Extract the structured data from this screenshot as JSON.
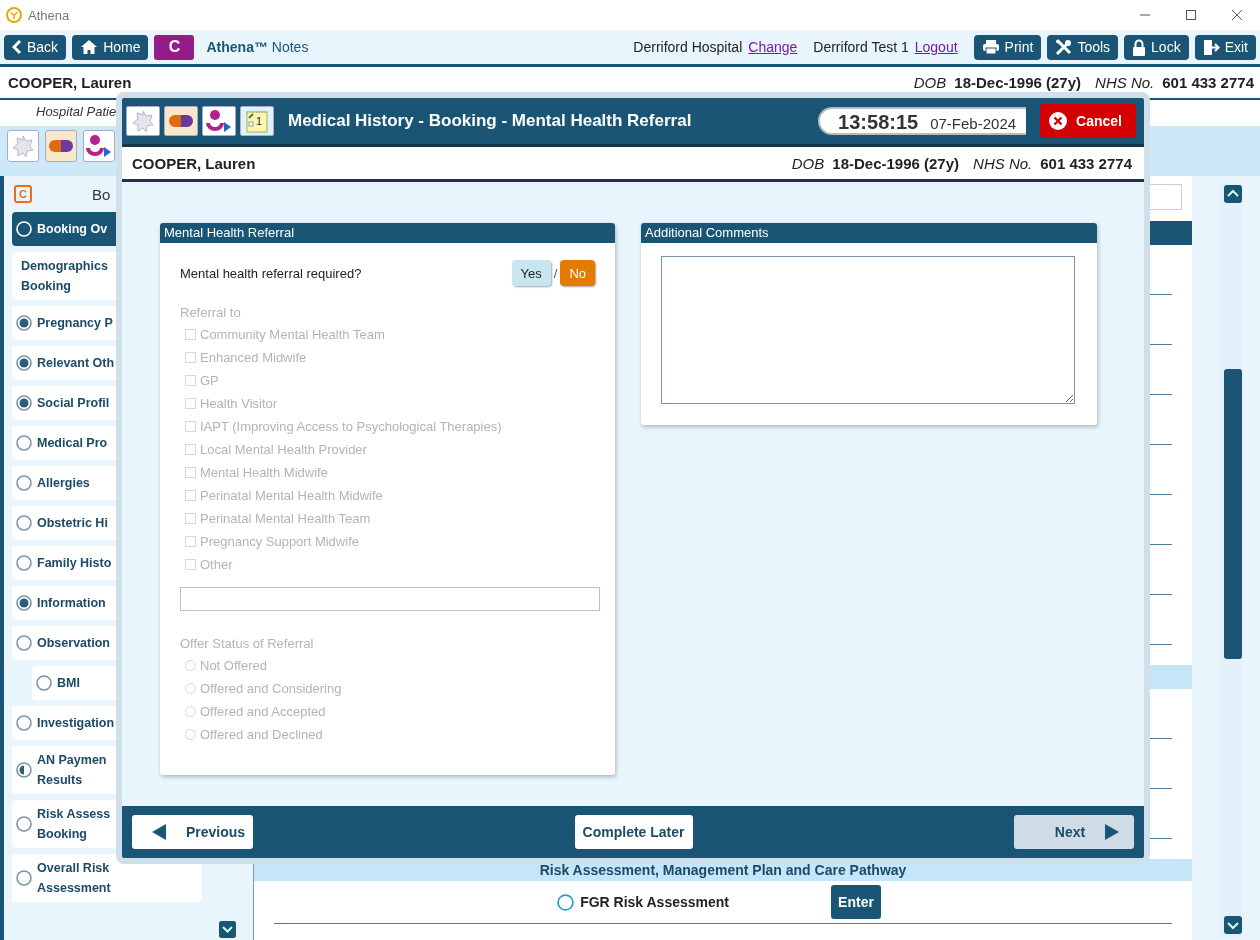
{
  "window": {
    "title": "Athena"
  },
  "toolbar": {
    "nav_buttons": [
      {
        "kind": "back",
        "label": "Back"
      },
      {
        "kind": "home",
        "label": "Home"
      }
    ],
    "badge": "C",
    "app_name": "**Athena™** Notes",
    "location": "Derriford Hospital",
    "change_link": "Change",
    "user": "Derriford Test 1",
    "logout_link": "Logout",
    "actions": [
      {
        "kind": "print",
        "label": "Print"
      },
      {
        "kind": "tools",
        "label": "Tools"
      },
      {
        "kind": "lock",
        "label": "Lock"
      },
      {
        "kind": "exit",
        "label": "Exit"
      }
    ]
  },
  "patient": {
    "name": "COOPER, Lauren",
    "dob_label": "DOB",
    "dob": "18-Dec-1996 (27y)",
    "nhs_label": "NHS No.",
    "nhs": "601 433 2774"
  },
  "patient_subtitle": "Hospital Patie",
  "quick_icons": [
    {
      "kind": "star"
    },
    {
      "kind": "pill"
    },
    {
      "kind": "person"
    }
  ],
  "sidebar": {
    "badge": "C",
    "header": "Bo",
    "items": [
      {
        "lines": [
          "Booking Ov"
        ],
        "kind": "empty",
        "selected": true
      },
      {
        "lines": [
          "Demographics",
          "Booking"
        ],
        "kind": "plain",
        "selected": false
      },
      {
        "lines": [
          "Pregnancy P"
        ],
        "kind": "complete",
        "selected": false
      },
      {
        "lines": [
          "Relevant Oth"
        ],
        "kind": "complete",
        "selected": false
      },
      {
        "lines": [
          "Social Profil"
        ],
        "kind": "complete",
        "selected": false
      },
      {
        "lines": [
          "Medical Pro"
        ],
        "kind": "empty",
        "selected": false
      },
      {
        "lines": [
          "Allergies"
        ],
        "kind": "empty",
        "selected": false
      },
      {
        "lines": [
          "Obstetric Hi"
        ],
        "kind": "empty",
        "selected": false
      },
      {
        "lines": [
          "Family Histo"
        ],
        "kind": "empty",
        "selected": false
      },
      {
        "lines": [
          "Information"
        ],
        "kind": "complete",
        "selected": false
      },
      {
        "lines": [
          "Observation"
        ],
        "kind": "empty",
        "selected": false,
        "children": [
          {
            "lines": [
              "BMI"
            ],
            "kind": "empty",
            "selected": false
          }
        ]
      },
      {
        "lines": [
          "Investigation"
        ],
        "kind": "empty",
        "selected": false
      },
      {
        "lines": [
          "AN Paymen",
          "Results"
        ],
        "kind": "partial",
        "selected": false
      },
      {
        "lines": [
          "Risk Assess",
          "Booking"
        ],
        "kind": "empty",
        "selected": false
      },
      {
        "lines": [
          "Overall Risk",
          "Assessment"
        ],
        "kind": "empty",
        "selected": false
      }
    ]
  },
  "background_pane": {
    "section": "Risk Assessment, Management Plan and Care Pathway",
    "rows": [
      {
        "label": "FGR Risk Assessment",
        "kind": "empty",
        "button": "Enter"
      }
    ]
  },
  "dialog": {
    "icons": [
      {
        "kind": "star"
      },
      {
        "kind": "pill"
      },
      {
        "kind": "person"
      },
      {
        "kind": "note",
        "label": "1"
      }
    ],
    "title": "Medical History - Booking - Mental Health Referral",
    "time": "13:58:15",
    "date": "07-Feb-2024",
    "cancel": "Cancel",
    "patient": {
      "name": "COOPER, Lauren",
      "dob_label": "DOB",
      "dob": "18-Dec-1996 (27y)",
      "nhs_label": "NHS No.",
      "nhs": "601 433 2774"
    },
    "referral": {
      "title": "Mental Health Referral",
      "question": "Mental health referral required?",
      "separator": "/",
      "answers": [
        {
          "label": "Yes",
          "selected": false
        },
        {
          "label": "No",
          "selected": true
        }
      ],
      "disabled": true,
      "referral_label": "Referral to",
      "referral_options": [
        {
          "label": "Community Mental Health Team",
          "checked": false
        },
        {
          "label": "Enhanced Midwife",
          "checked": false
        },
        {
          "label": "GP",
          "checked": false
        },
        {
          "label": "Health Visitor",
          "checked": false
        },
        {
          "label": "IAPT (Improving Access to Psychological Therapies)",
          "checked": false
        },
        {
          "label": "Local Mental Health Provider",
          "checked": false
        },
        {
          "label": "Mental Health Midwife",
          "checked": false
        },
        {
          "label": "Perinatal Mental Health Midwife",
          "checked": false
        },
        {
          "label": "Perinatal Mental Health Team",
          "checked": false
        },
        {
          "label": "Pregnancy Support Midwife",
          "checked": false
        },
        {
          "label": "Other",
          "checked": false
        }
      ],
      "offer_label": "Offer Status of Referral",
      "offer_options": [
        {
          "label": "Not Offered",
          "selected": false
        },
        {
          "label": "Offered and Considering",
          "selected": false
        },
        {
          "label": "Offered and Accepted",
          "selected": false
        },
        {
          "label": "Offered and Declined",
          "selected": false
        }
      ]
    },
    "comments": {
      "title": "Additional Comments"
    },
    "footer": {
      "previous": "Previous",
      "complete_later": "Complete Later",
      "next": "Next",
      "next_disabled": true
    }
  }
}
